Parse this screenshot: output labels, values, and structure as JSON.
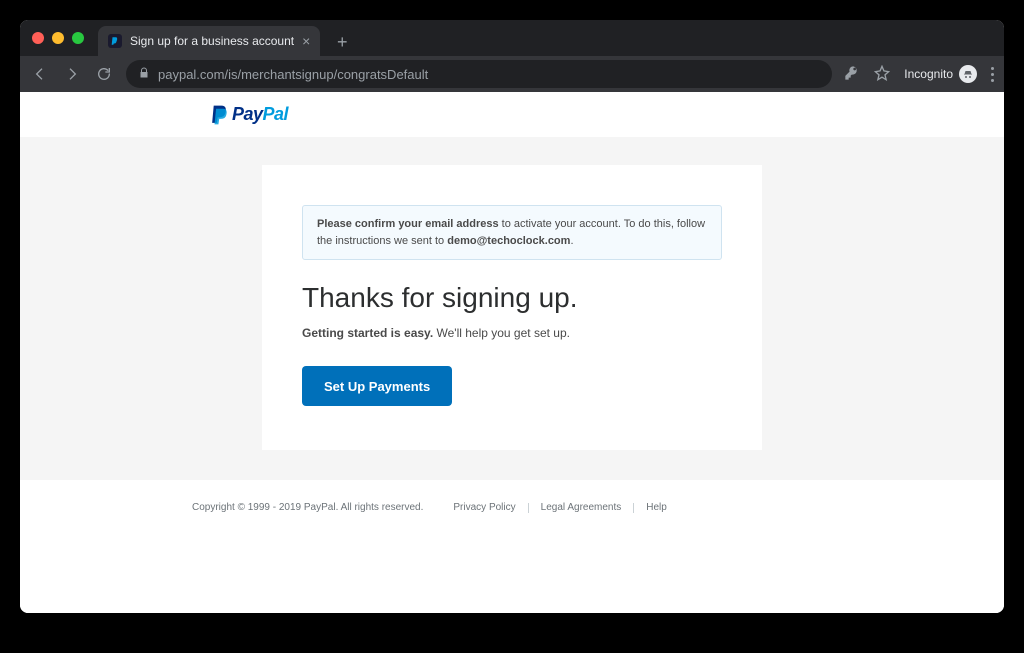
{
  "browser": {
    "tab_title": "Sign up for a business account",
    "url": "paypal.com/is/merchantsignup/congratsDefault",
    "incognito_label": "Incognito"
  },
  "header": {
    "logo_pay": "Pay",
    "logo_pal": "Pal"
  },
  "notice": {
    "bold": "Please confirm your email address",
    "rest": " to activate your account. To do this, follow the instructions we sent to ",
    "email": "demo@techoclock.com",
    "period": "."
  },
  "main": {
    "heading": "Thanks for signing up.",
    "sub_bold": "Getting started is easy.",
    "sub_rest": " We'll help you get set up.",
    "cta": "Set Up Payments"
  },
  "footer": {
    "copyright": "Copyright © 1999 - 2019 PayPal. All rights reserved.",
    "links": [
      "Privacy Policy",
      "Legal Agreements",
      "Help"
    ]
  }
}
